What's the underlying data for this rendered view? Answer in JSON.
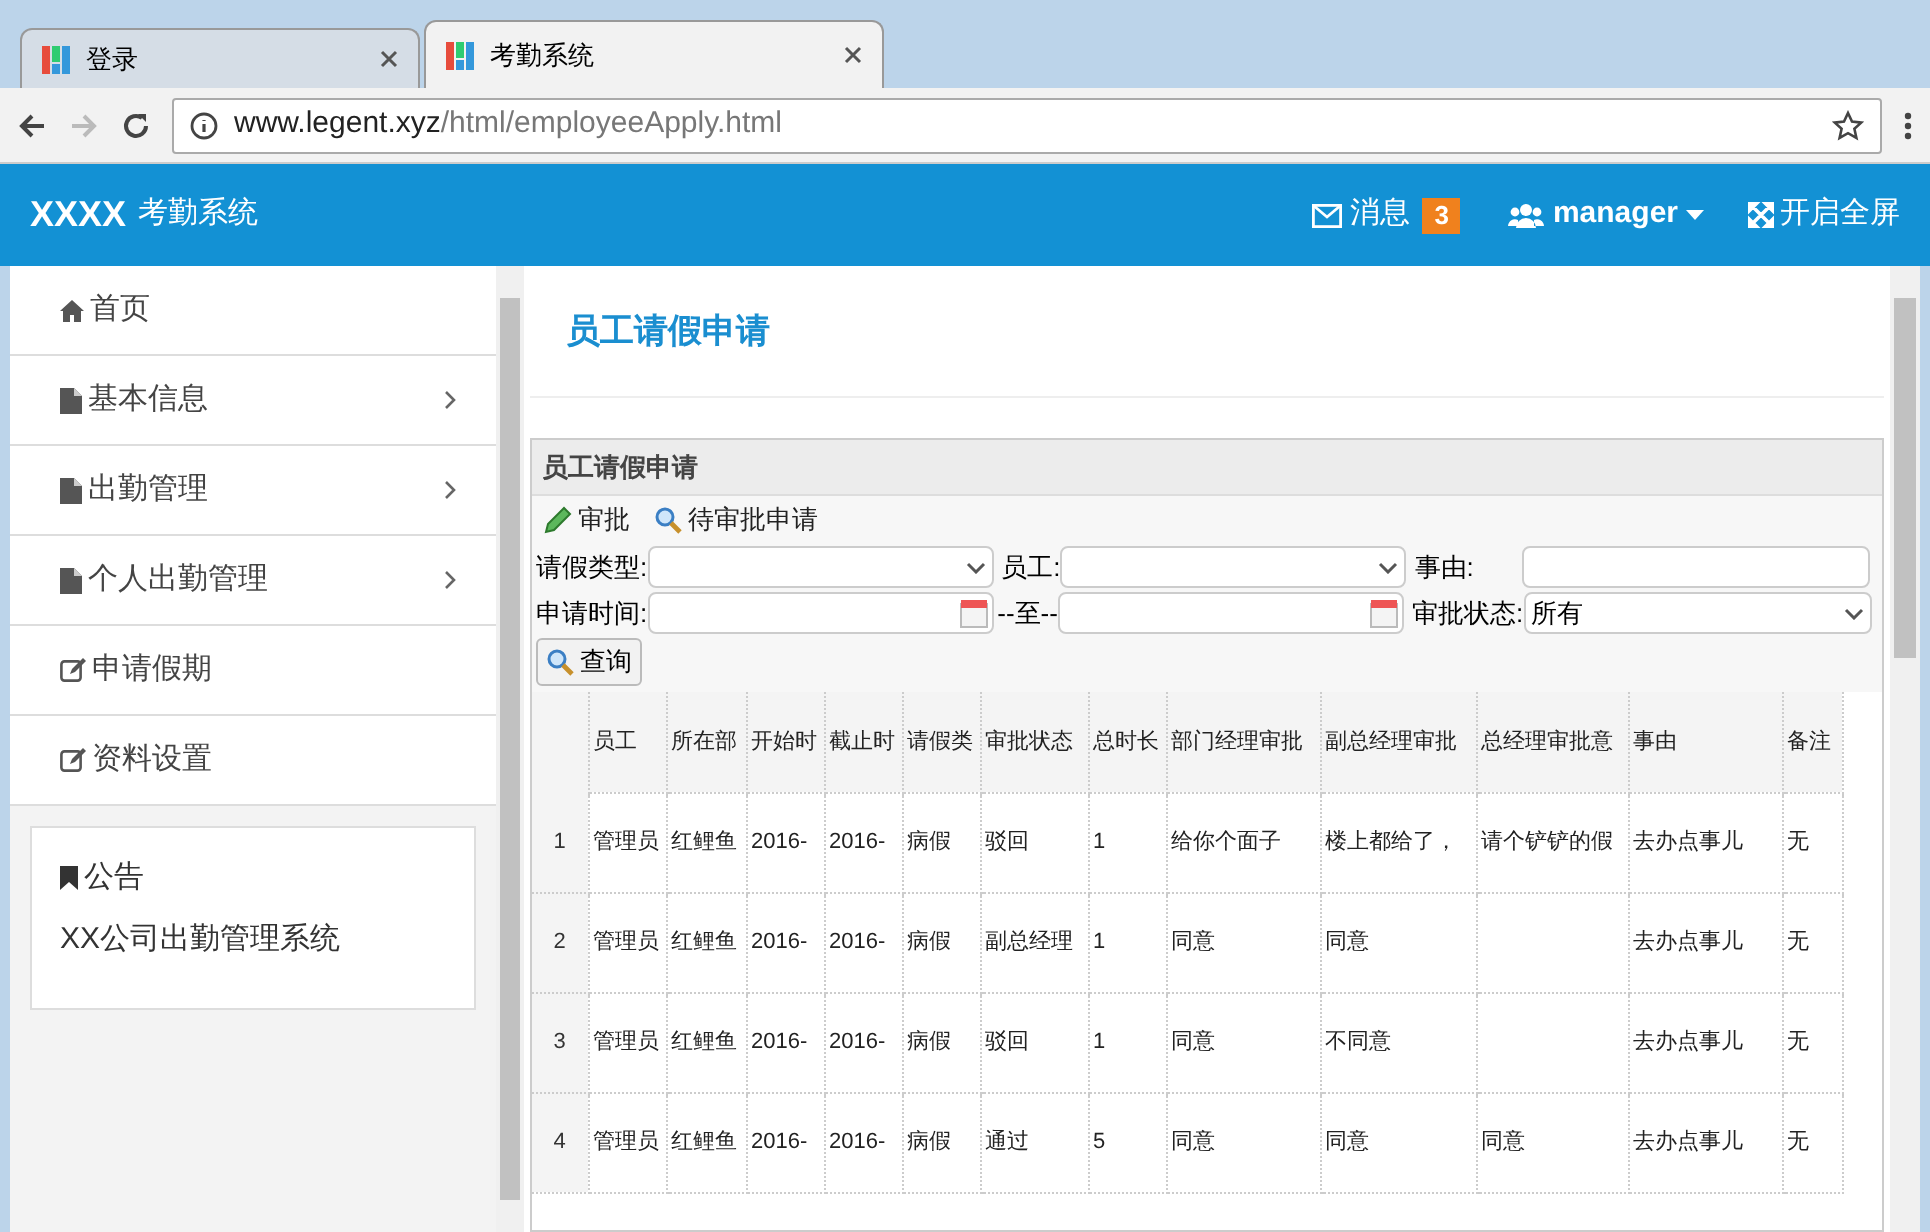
{
  "browser": {
    "tabs": [
      {
        "label": "登录",
        "selected": false
      },
      {
        "label": "考勤系统",
        "selected": true
      }
    ],
    "url_host": "www.legent.xyz",
    "url_path": "/html/employeeApply.html"
  },
  "header": {
    "brand": "XXXX",
    "app_name": "考勤系统",
    "messages": "消息",
    "message_count": "3",
    "user": "manager",
    "fullscreen": "开启全屏"
  },
  "sidebar": {
    "items": [
      {
        "label": "首页",
        "kind": "home",
        "has_submenu": false
      },
      {
        "label": "基本信息",
        "kind": "file",
        "has_submenu": true
      },
      {
        "label": "出勤管理",
        "kind": "file",
        "has_submenu": true
      },
      {
        "label": "个人出勤管理",
        "kind": "file",
        "has_submenu": true
      },
      {
        "label": "申请假期",
        "kind": "edit",
        "has_submenu": false
      },
      {
        "label": "资料设置",
        "kind": "edit",
        "has_submenu": false
      }
    ],
    "notice": {
      "title": "公告",
      "text": "XX公司出勤管理系统"
    }
  },
  "page_title": "员工请假申请",
  "panel": {
    "title": "员工请假申请",
    "toolbar": [
      {
        "label": "审批",
        "kind": "edit"
      },
      {
        "label": "待审批申请",
        "kind": "search"
      }
    ],
    "filters": {
      "leave_type_label": "请假类型:",
      "employee_label": "员工:",
      "reason_label": "事由:",
      "time_label": "申请时间:",
      "to_label": "--至--",
      "status_label": "审批状态:",
      "status_value": "所有"
    },
    "query_button": "查询"
  },
  "table": {
    "columns": [
      "员工",
      "所在部",
      "开始时",
      "截止时",
      "请假类",
      "审批状态",
      "总时长",
      "部门经理审批",
      "副总经理审批",
      "总经理审批意",
      "事由",
      "备注"
    ],
    "rows": [
      {
        "number": "1",
        "cells": [
          "管理员",
          "红鲤鱼",
          "2016-",
          "2016-",
          "病假",
          "驳回",
          "1",
          "给你个面子",
          "楼上都给了，",
          "请个铲铲的假",
          "去办点事儿",
          "无"
        ]
      },
      {
        "number": "2",
        "cells": [
          "管理员",
          "红鲤鱼",
          "2016-",
          "2016-",
          "病假",
          "副总经理",
          "1",
          "同意",
          "同意",
          "",
          "去办点事儿",
          "无"
        ]
      },
      {
        "number": "3",
        "cells": [
          "管理员",
          "红鲤鱼",
          "2016-",
          "2016-",
          "病假",
          "驳回",
          "1",
          "同意",
          "不同意",
          "",
          "去办点事儿",
          "无"
        ]
      },
      {
        "number": "4",
        "cells": [
          "管理员",
          "红鲤鱼",
          "2016-",
          "2016-",
          "病假",
          "通过",
          "5",
          "同意",
          "同意",
          "同意",
          "去办点事儿",
          "无"
        ]
      }
    ]
  }
}
